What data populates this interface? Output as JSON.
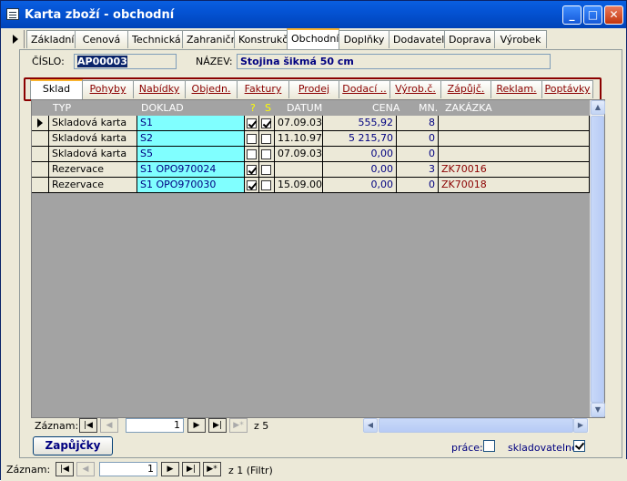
{
  "window": {
    "title": "Karta zboží - obchodní"
  },
  "main_tabs": [
    "Základní",
    "Cenová",
    "Technická",
    "Zahraničn",
    "Konstrukč",
    "Obchodní",
    "Doplňky",
    "Dodavatel",
    "Doprava",
    "Výrobek"
  ],
  "main_tabs_active": "Obchodní",
  "header": {
    "cislo_label": "ČÍSLO:",
    "cislo_value": "AP00003",
    "nazev_label": "NÁZEV:",
    "nazev_value": "Stojina šikmá 50 cm"
  },
  "sub_tabs": [
    "Sklad",
    "Pohyby",
    "Nabídky",
    "Objedn.",
    "Faktury",
    "Prodej",
    "Dodací ..",
    "Výrob.č.",
    "Zápůjč.",
    "Reklam.",
    "Poptávky"
  ],
  "sub_tabs_active": "Sklad",
  "grid": {
    "columns": {
      "typ": "TYP",
      "doklad": "DOKLAD",
      "q": "?",
      "s": "S",
      "datum": "DATUM",
      "cena": "CENA",
      "mn": "MN.",
      "zakazka": "ZAKÁZKA"
    },
    "rows": [
      {
        "typ": "Skladová karta",
        "doklad": "S1",
        "q": true,
        "s": true,
        "datum": "07.09.03",
        "cena": "555,92",
        "mn": "8",
        "zakazka": "",
        "current": true
      },
      {
        "typ": "Skladová karta",
        "doklad": "S2",
        "q": false,
        "s": false,
        "datum": "11.10.97",
        "cena": "5 215,70",
        "mn": "0",
        "zakazka": ""
      },
      {
        "typ": "Skladová karta",
        "doklad": "S5",
        "q": false,
        "s": false,
        "datum": "07.09.03",
        "cena": "0,00",
        "mn": "0",
        "zakazka": ""
      },
      {
        "typ": "Rezervace",
        "doklad": "S1   OPO970024",
        "q": true,
        "s": false,
        "datum": "",
        "cena": "0,00",
        "mn": "3",
        "zakazka": "ZK70016"
      },
      {
        "typ": "Rezervace",
        "doklad": "S1   OPO970030",
        "q": true,
        "s": false,
        "datum": "15.09.00",
        "cena": "0,00",
        "mn": "0",
        "zakazka": "ZK70018"
      }
    ]
  },
  "sub_nav": {
    "label": "Záznam:",
    "current": "1",
    "of_label": "z 5"
  },
  "bottom_controls": {
    "zapujcky_button": "Zapůjčky",
    "prace_label": "práce:",
    "prace_checked": false,
    "skladovatelne_label": "skladovatelné:",
    "skladovatelne_checked": true
  },
  "main_nav": {
    "label": "Záznam:",
    "current": "1",
    "of_label": "z 1 (Filtr)"
  }
}
